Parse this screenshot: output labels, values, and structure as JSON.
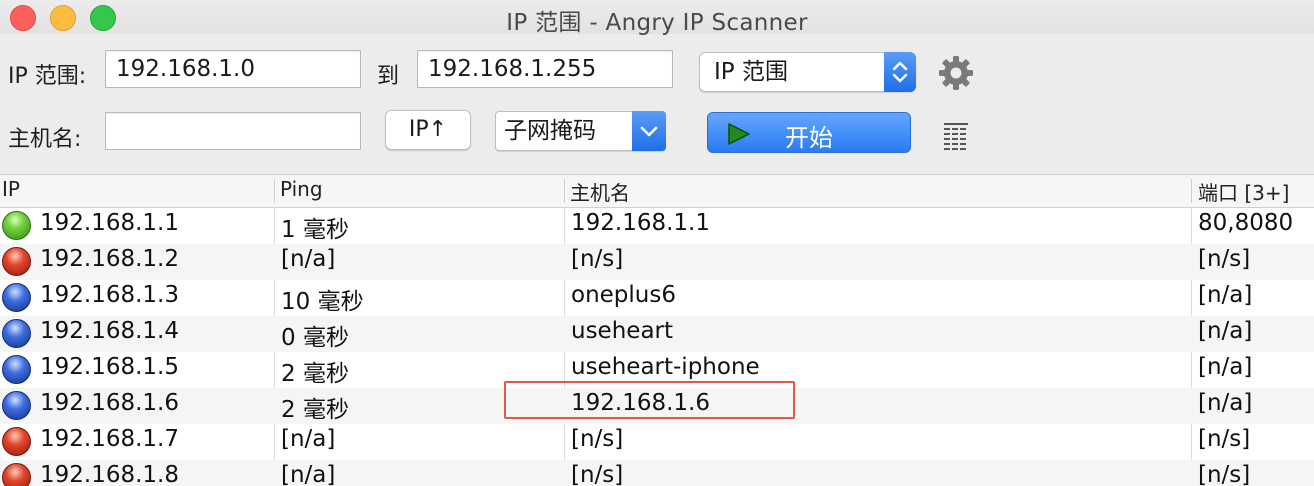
{
  "window": {
    "title": "IP 范围 - Angry IP Scanner"
  },
  "toolbar": {
    "range_label": "IP 范围:",
    "start_ip": "192.168.1.0",
    "to_label": "到",
    "end_ip": "192.168.1.255",
    "feeder_select": "IP 范围",
    "hostname_label": "主机名:",
    "hostname_value": "",
    "ip_up_button": "IP↑",
    "netmask_select": "子网掩码",
    "start_button": "开始"
  },
  "table": {
    "columns": [
      "IP",
      "Ping",
      "主机名",
      "端口 [3+]"
    ],
    "rows": [
      {
        "status": "green",
        "ip": "192.168.1.1",
        "ping": "1 毫秒",
        "hostname": "192.168.1.1",
        "ports": "80,8080"
      },
      {
        "status": "red",
        "ip": "192.168.1.2",
        "ping": "[n/a]",
        "hostname": "[n/s]",
        "ports": "[n/s]"
      },
      {
        "status": "blue",
        "ip": "192.168.1.3",
        "ping": "10 毫秒",
        "hostname": "oneplus6",
        "ports": "[n/a]"
      },
      {
        "status": "blue",
        "ip": "192.168.1.4",
        "ping": "0 毫秒",
        "hostname": "useheart",
        "ports": "[n/a]"
      },
      {
        "status": "blue",
        "ip": "192.168.1.5",
        "ping": "2 毫秒",
        "hostname": "useheart-iphone",
        "ports": "[n/a]"
      },
      {
        "status": "blue",
        "ip": "192.168.1.6",
        "ping": "2 毫秒",
        "hostname": "192.168.1.6",
        "ports": "[n/a]"
      },
      {
        "status": "red",
        "ip": "192.168.1.7",
        "ping": "[n/a]",
        "hostname": "[n/s]",
        "ports": "[n/s]"
      },
      {
        "status": "red",
        "ip": "192.168.1.8",
        "ping": "[n/a]",
        "hostname": "[n/s]",
        "ports": "[n/s]"
      }
    ]
  },
  "colors": {
    "start_button": "#2a7bf1",
    "highlight_box": "#e2584e",
    "alive": "#73d23c",
    "dead": "#e2452c",
    "no_ports": "#3e6fe0"
  },
  "icons": [
    "gear-icon",
    "play-icon",
    "columns-icon",
    "chevron-updown-icon",
    "chevron-down-icon"
  ]
}
